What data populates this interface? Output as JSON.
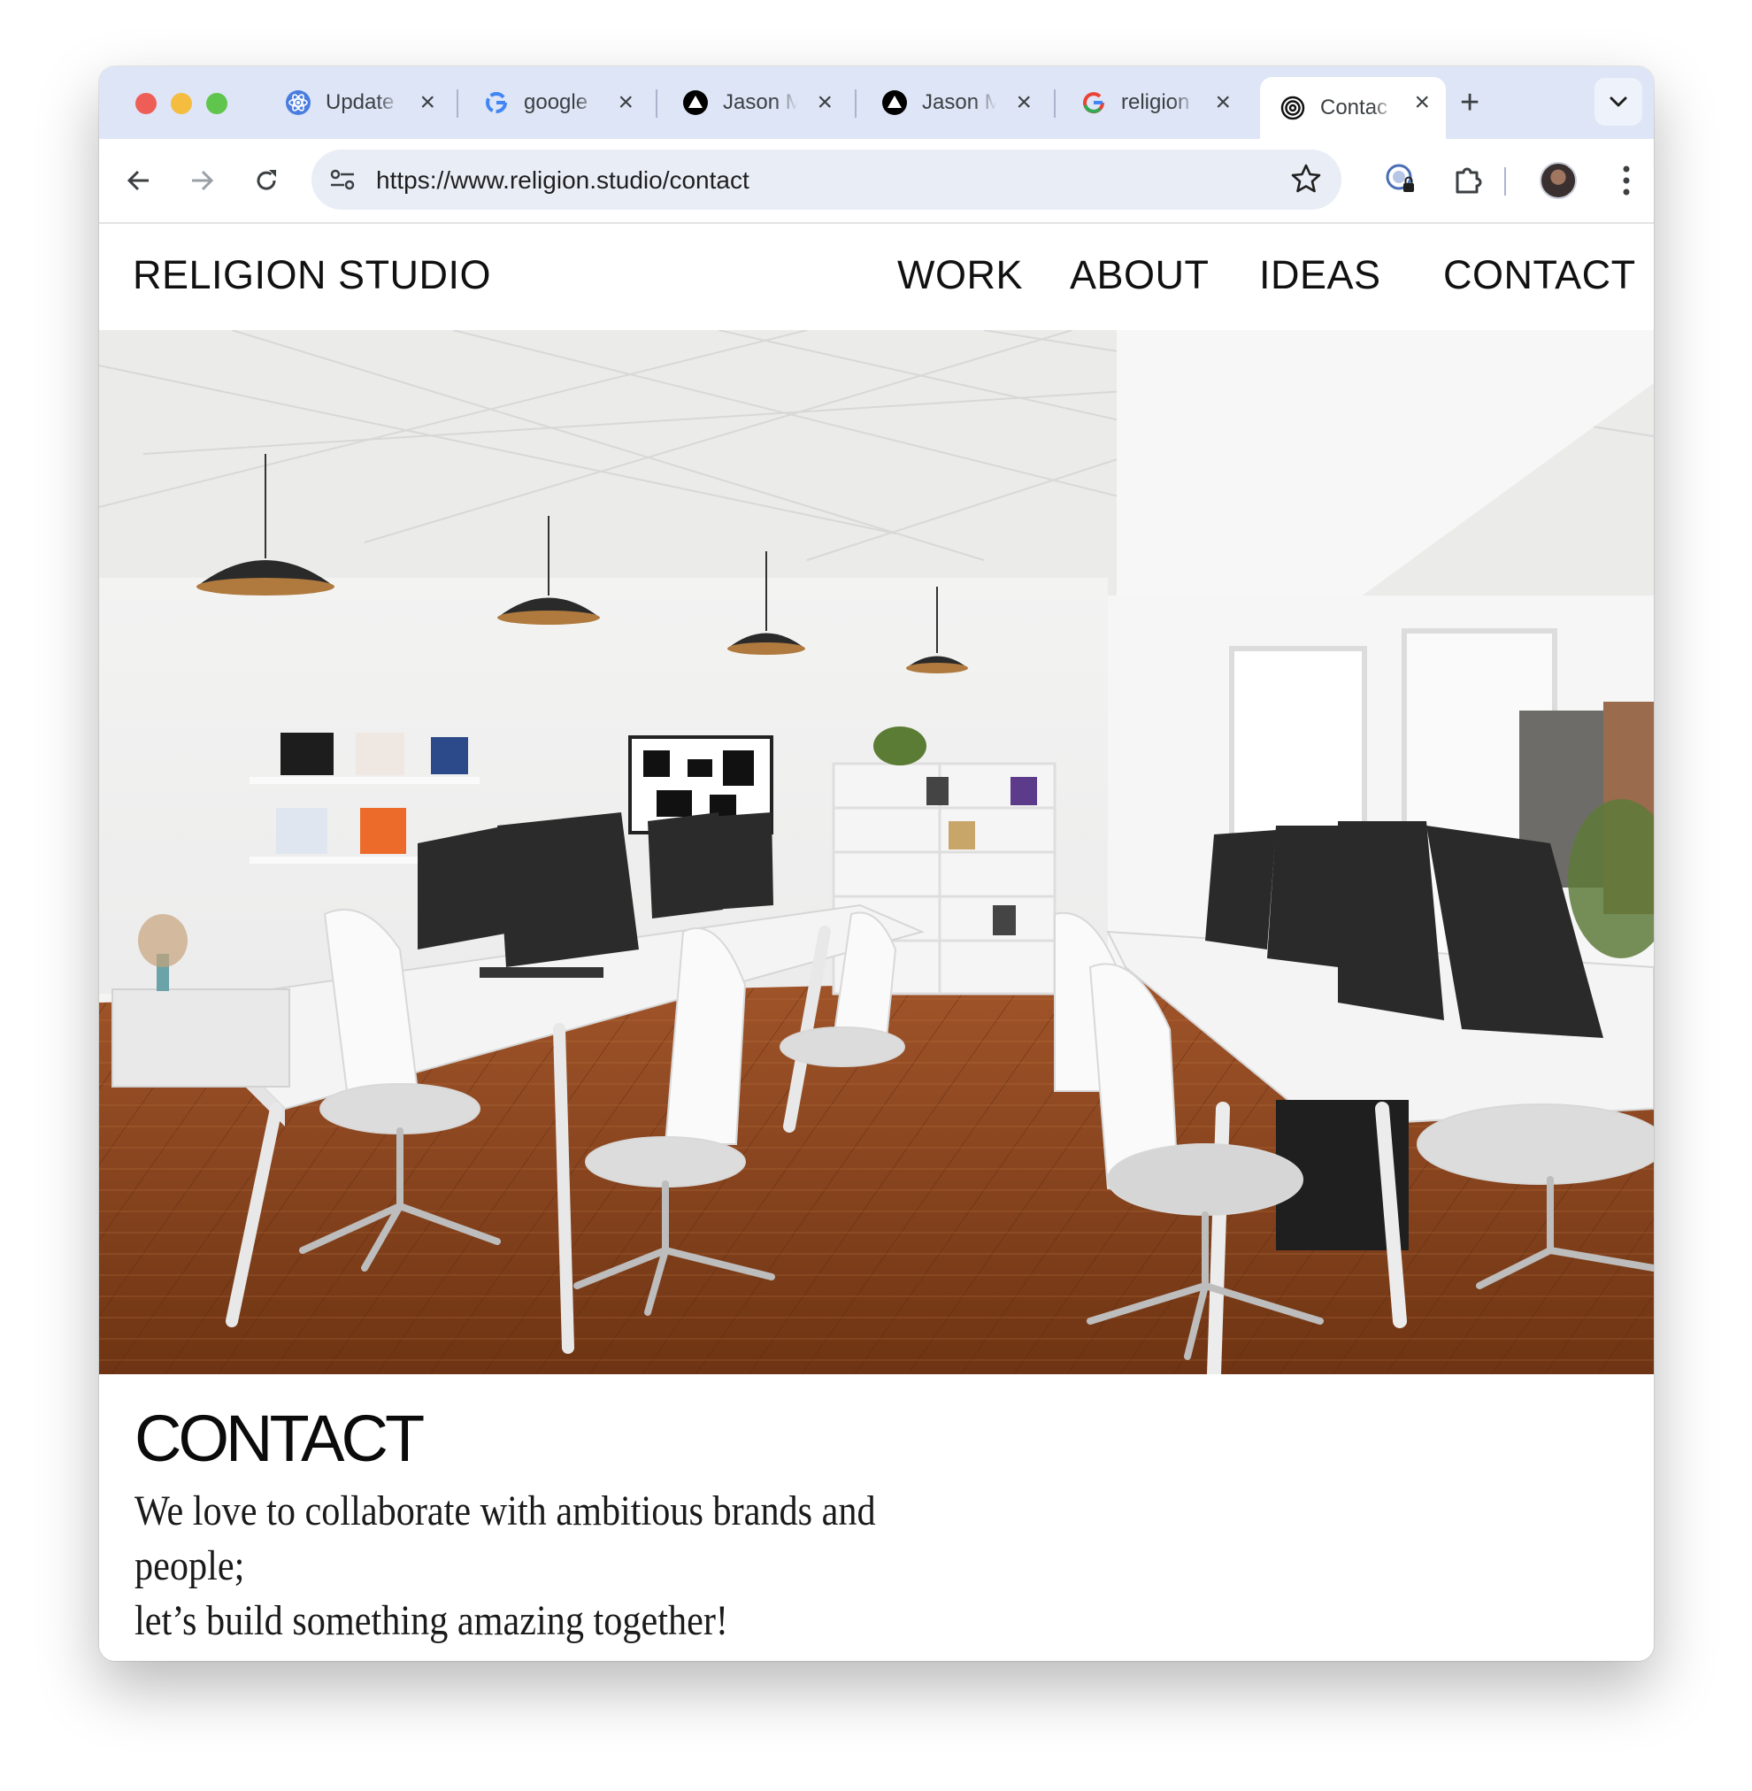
{
  "browser": {
    "tabs": [
      {
        "title": "Update",
        "favicon": "react-icon"
      },
      {
        "title": "google",
        "favicon": "google-icon"
      },
      {
        "title": "Jason M",
        "favicon": "vercel-icon"
      },
      {
        "title": "Jason M",
        "favicon": "vercel-icon"
      },
      {
        "title": "religion",
        "favicon": "google-icon"
      },
      {
        "title": "Contac",
        "favicon": "spiral-icon",
        "active": true
      }
    ],
    "new_tab_label": "+",
    "url": "https://www.religion.studio/contact"
  },
  "site": {
    "logo": "RELIGION STUDIO",
    "nav": [
      {
        "label": "WORK"
      },
      {
        "label": "ABOUT"
      },
      {
        "label": "IDEAS"
      },
      {
        "label": "CONTACT"
      }
    ],
    "hero_image": "office-interior-photo",
    "contact": {
      "title": "CONTACT",
      "text_line1": "We love to collaborate with ambitious brands and people;",
      "text_line2": "let’s build something amazing together!"
    }
  }
}
